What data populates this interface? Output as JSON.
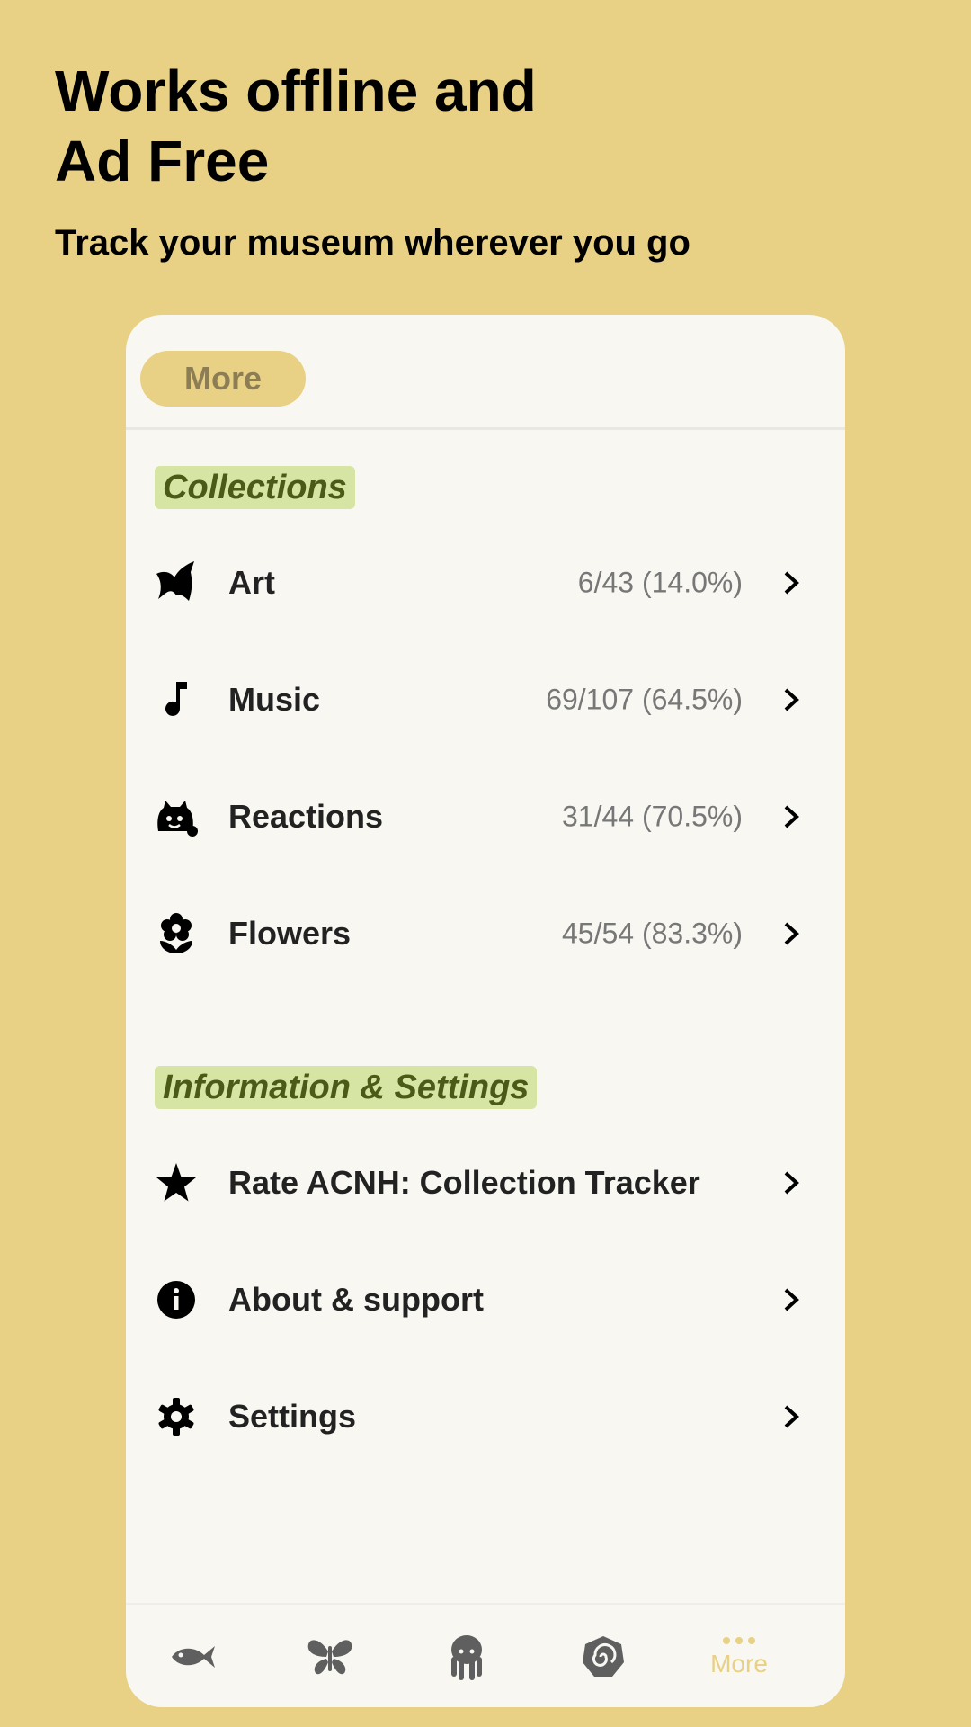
{
  "promo": {
    "headline_line1": "Works offline and",
    "headline_line2": "Ad Free",
    "subline": "Track your museum wherever you go"
  },
  "header": {
    "title": "More"
  },
  "collections": {
    "title": "Collections",
    "items": [
      {
        "label": "Art",
        "count": "6/43 (14.0%)",
        "icon": "art-leaf-icon"
      },
      {
        "label": "Music",
        "count": "69/107 (64.5%)",
        "icon": "music-note-icon"
      },
      {
        "label": "Reactions",
        "count": "31/44 (70.5%)",
        "icon": "reaction-face-icon"
      },
      {
        "label": "Flowers",
        "count": "45/54 (83.3%)",
        "icon": "flower-icon"
      }
    ]
  },
  "info": {
    "title": "Information & Settings",
    "items": [
      {
        "label": "Rate ACNH: Collection Tracker",
        "icon": "star-icon"
      },
      {
        "label": "About & support",
        "icon": "info-icon"
      },
      {
        "label": "Settings",
        "icon": "gear-icon"
      }
    ]
  },
  "bottom_nav": {
    "items": [
      {
        "icon": "fish-icon"
      },
      {
        "icon": "butterfly-icon"
      },
      {
        "icon": "octopus-icon"
      },
      {
        "icon": "fossil-icon"
      },
      {
        "icon": "more-dots-icon",
        "label": "More"
      }
    ]
  },
  "colors": {
    "background": "#e8d184",
    "card": "#f8f7f2",
    "section_highlight": "#d6e4a4",
    "section_text": "#4c5a17"
  }
}
